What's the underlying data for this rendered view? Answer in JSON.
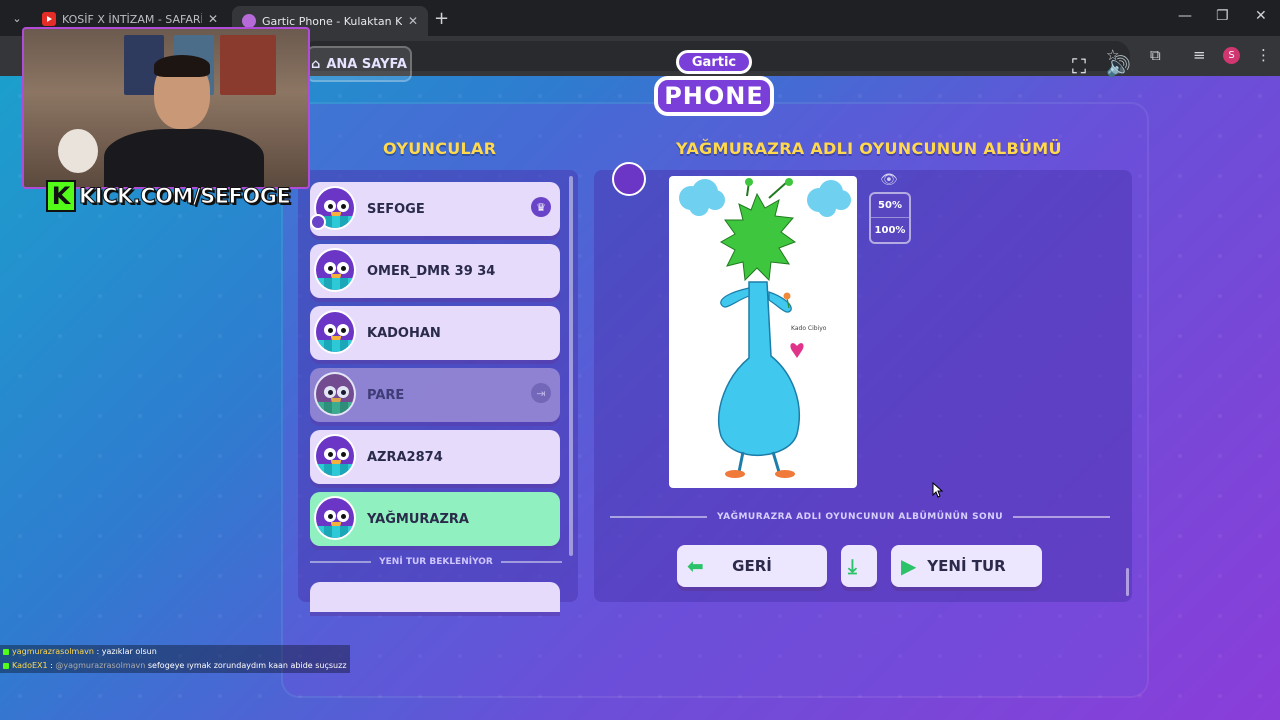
{
  "browser": {
    "tabs": [
      {
        "title": "KOSİF X İNTİZAM - SAFARİ ( OF",
        "icon": "youtube-icon"
      },
      {
        "title": "Gartic Phone - Kulaktan Kulağa",
        "icon": "gartic-icon"
      }
    ],
    "profile_initial": "S"
  },
  "header": {
    "home_label": "ANA SAYFA",
    "logo_top": "Gartic",
    "logo_bottom": "PHONE"
  },
  "players_panel": {
    "title": "OYUNCULAR",
    "players": [
      {
        "name": "SEFOGE",
        "badge": "crown",
        "state": "normal"
      },
      {
        "name": "OMER_DMR 39 34",
        "state": "normal"
      },
      {
        "name": "KADOHAN",
        "state": "normal"
      },
      {
        "name": "PARE",
        "badge": "exit",
        "state": "left"
      },
      {
        "name": "AZRA2874",
        "state": "normal"
      },
      {
        "name": "YAĞMURAZRA",
        "state": "active"
      }
    ],
    "waiting_label": "YENİ TUR BEKLENİYOR"
  },
  "album": {
    "title": "YAĞMURAZRA ADLI OYUNCUNUN ALBÜMÜ",
    "zoom_options": [
      "50%",
      "100%"
    ],
    "end_label": "YAĞMURAZRA ADLI OYUNCUNUN ALBÜMÜNÜN SONU",
    "drawing_note": "Kado Cibiyo"
  },
  "buttons": {
    "back": "GERİ",
    "new_round": "YENİ TUR"
  },
  "overlay": {
    "kick_url": "KICK.COM/SEFOGE",
    "chat": [
      {
        "user": "yagmurazrasolmavn",
        "sep": " : ",
        "text": "yazıklar olsun"
      },
      {
        "user": "KadoEX1",
        "sep": " : ",
        "mention": "@yagmurazrasolmavn",
        "text": " sefogeye ıymak zorundaydım kaan abide suçsuzz"
      }
    ]
  },
  "colors": {
    "heading": "#ffd84d",
    "active_player": "#90f0c0",
    "accent_green": "#2bc26a",
    "kick_green": "#53fc18"
  }
}
